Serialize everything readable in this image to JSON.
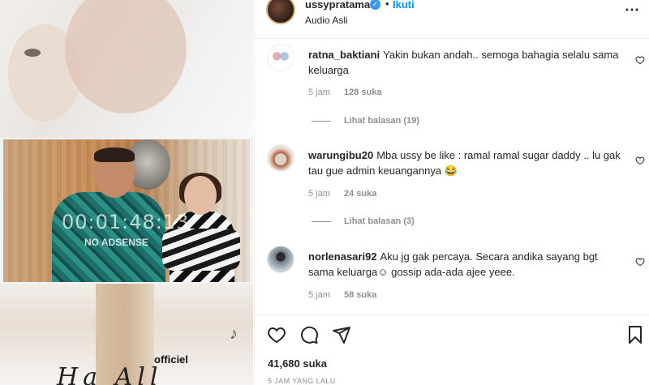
{
  "media": {
    "timer": "00:01:48:13",
    "watermark": "NO ADSENSE",
    "overlay_text": "officiel",
    "tiktok_icon": "tiktok-icon",
    "signature_text": "Ha All"
  },
  "header": {
    "username": "ussypratama",
    "verified_icon": "verified-badge-icon",
    "dot": "•",
    "follow_label": "Ikuti",
    "audio_label": "Audio Asli",
    "more_icon": "more-options-icon"
  },
  "comments": [
    {
      "username": "ratna_baktiani",
      "text": "Yakin bukan andah.. semoga bahagia selalu sama keluarga",
      "time": "5 jam",
      "likes": "128 suka",
      "replies": "Lihat balasan (19)"
    },
    {
      "username": "warungibu20",
      "text": "Mba ussy be like : ramal ramal sugar daddy .. lu gak tau gue admin keuangannya 😂",
      "time": "5 jam",
      "likes": "24 suka",
      "replies": "Lihat balasan (3)"
    },
    {
      "username": "norlenasari92",
      "text": "Aku jg gak percaya. Secara andika sayang bgt sama keluarga☺ gossip ada-ada ajee yeee.",
      "time": "5 jam",
      "likes": "58 suka",
      "replies": ""
    }
  ],
  "actions": {
    "icons": [
      "heart-icon",
      "comment-icon",
      "share-icon",
      "bookmark-icon"
    ]
  },
  "footer": {
    "likes_total": "41,680 suka",
    "time_ago": "5 JAM YANG LALU"
  },
  "colors": {
    "link_blue": "#0095f6",
    "verified_blue": "#3897f0",
    "muted": "#8e8e8e",
    "text": "#262626"
  }
}
